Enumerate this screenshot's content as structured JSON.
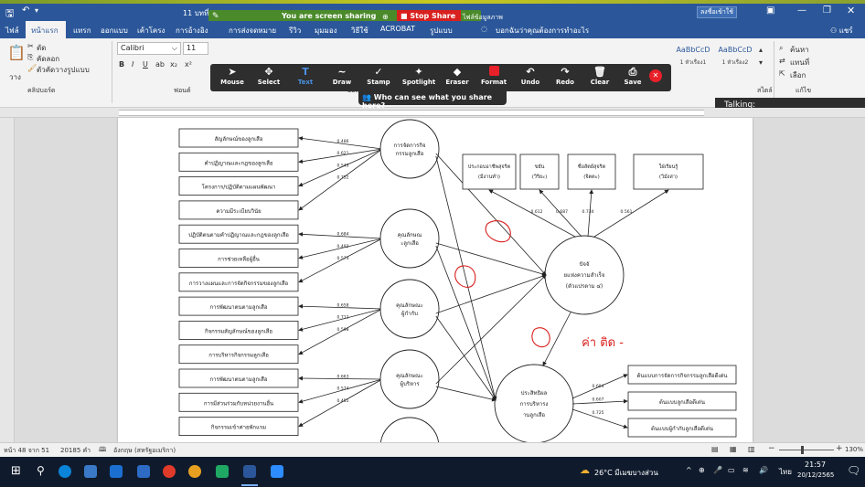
{
  "title": {
    "doc_name": "11 บทที่ 4_201265",
    "sharing_text": "You are screen sharing",
    "stop_share": "Stop Share",
    "extra": "ไฟล์ข้อมูลภาพ",
    "signin": "ลงชื่อเข้าใช้",
    "date_corner": "20/12/2565"
  },
  "tabs": [
    "ไฟล์",
    "หน้าแรก",
    "แทรก",
    "ออกแบบ",
    "เค้าโครง",
    "การอ้างอิง",
    "การส่งจดหมาย",
    "รีวิว",
    "มุมมอง",
    "วิธีใช้",
    "ACROBAT",
    "รูปแบบ"
  ],
  "tell_me": "บอกฉันว่าคุณต้องการทำอะไร",
  "share_label": "แชร์",
  "ribbon": {
    "paste": "วาง",
    "cut": "ตัด",
    "copy": "คัดลอก",
    "format_painter": "ตัวคัดวางรูปแบบ",
    "clipboard": "คลิปบอร์ด",
    "font_name": "Calibri",
    "font_size": "11",
    "font_group": "ฟอนต์",
    "styles_group": "สไตล์",
    "style1": "AaBbCcD",
    "style1_name": "1 หัวเรื่อง1",
    "style2": "AaBbCcD",
    "style2_name": "1 หัวเรื่อง2",
    "find": "ค้นหา",
    "replace": "แทนที่",
    "select": "เลือก",
    "paragraph_group": "ย่อหน้า",
    "edit_group": "แก้ไข"
  },
  "zoom_toolbar": [
    "Mouse",
    "Select",
    "Text",
    "Draw",
    "Stamp",
    "Spotlight",
    "Eraser",
    "Format",
    "Undo",
    "Redo",
    "Clear",
    "Save"
  ],
  "who_can_see": "Who can see what you share here?",
  "talking": "Talking:",
  "diagram": {
    "left_boxes": [
      "สัญลักษณ์ของลูกเสือ",
      "คำปฏิญาณและกฎของลูกเสือ",
      "โครงการ/ปฏิบัติตามแผนพัฒนา",
      "ความมีระเบียบวินัย",
      "ปฏิบัติตนตามคำปฏิญาณและกฎของลูกเสือ",
      "การช่วยเหลือผู้อื่น",
      "การวางแผนและการจัดกิจกรรมของลูกเสือ",
      "การพัฒนาตนตามลูกเสือ",
      "กิจกรรมสัญลักษณ์ของลูกเสือ",
      "การบริหารกิจกรรมลูกเสือ",
      "การพัฒนาตนตามลูกเสือ",
      "การมีส่วนร่วมกับหน่วยงานอื่น",
      "กิจกรรมเข้าค่ายพักแรม"
    ],
    "circles": [
      "การจัดการกิจกรรมลูกเสือ",
      "คุณลักษณะลูกเสือ",
      "คุณลักษณะผู้กำกับ",
      "คุณลักษณะผู้บริหาร"
    ],
    "center_circle": "ปัจจัยแห่งความสำเร็จ (ตัวแปรตาม ๔)",
    "bottom_circle": "ประสิทธิผลการบริหารงานลูกเสือ",
    "top_boxes": [
      "ประกอบอาชีพสุจริต (มีงานทำ)",
      "ขยัน (วิริยะ)",
      "ซื่อสัตย์สุจริต (จิตตะ)",
      "ใฝ่เรียนรู้ (วิมังสา)"
    ],
    "right_boxes": [
      "ต้นแบบการจัดการกิจกรรมลูกเสือดีเด่น",
      "ต้นแบบลูกเสือดีเด่น",
      "ต้นแบบผู้กำกับลูกเสือดีเด่น"
    ],
    "annotation": "ค่า ติด -",
    "edge_labels": [
      "0.486",
      "0.621",
      "0.543",
      "0.752",
      "0.684",
      "0.492",
      "0.573",
      "0.658",
      "0.712",
      "0.598",
      "0.663",
      "0.574",
      "0.455",
      "0.612",
      "0.687",
      "0.734",
      "0.561",
      "0.694",
      "0.607",
      "0.725",
      "0.533",
      "0.644",
      "0.701"
    ]
  },
  "status": {
    "page": "หน้า 48 จาก 51",
    "words": "20185 คำ",
    "lang": "อังกฤษ (สหรัฐอเมริกา)",
    "zoom": "130%"
  },
  "taskbar": {
    "weather": "26°C มีเมฆบางส่วน",
    "lang": "ไทย",
    "time": "21:57",
    "date": "20/12/2565"
  },
  "colors": {
    "word_blue": "#2b579a",
    "share_green": "#4a8a2a",
    "stop_red": "#d8201e",
    "annotation_red": "#d8201e",
    "taskbar": "#0f1b2d"
  }
}
